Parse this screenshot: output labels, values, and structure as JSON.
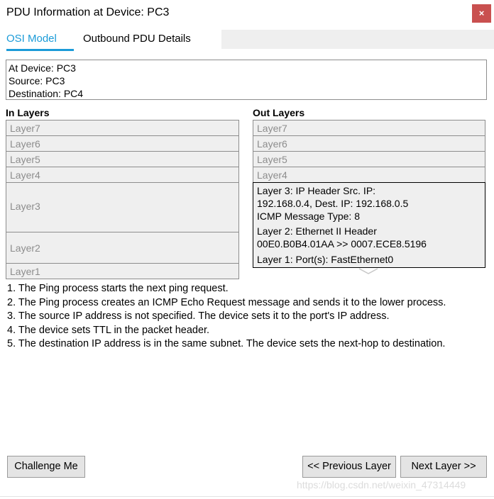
{
  "window": {
    "title": "PDU Information at Device: PC3",
    "close_label": "×",
    "close_icon": "close-icon",
    "accent_color": "#1b9bd8",
    "close_color": "#c9504f"
  },
  "tabs": [
    {
      "label": "OSI Model",
      "selected": true
    },
    {
      "label": "Outbound PDU Details",
      "selected": false
    }
  ],
  "info": {
    "at_device": "At Device: PC3",
    "source": "Source: PC3",
    "destination": "Destination: PC4"
  },
  "columns": {
    "in_heading": "In Layers",
    "out_heading": "Out Layers"
  },
  "in_layers": [
    {
      "text": "Layer7",
      "active": false
    },
    {
      "text": "Layer6",
      "active": false
    },
    {
      "text": "Layer5",
      "active": false
    },
    {
      "text": "Layer4",
      "active": false
    },
    {
      "text": "Layer3",
      "active": false
    },
    {
      "text": "Layer2",
      "active": false
    },
    {
      "text": "Layer1",
      "active": false
    }
  ],
  "out_layers": [
    {
      "lines": [
        "Layer7"
      ],
      "active": false
    },
    {
      "lines": [
        "Layer6"
      ],
      "active": false
    },
    {
      "lines": [
        "Layer5"
      ],
      "active": false
    },
    {
      "lines": [
        "Layer4"
      ],
      "active": false
    },
    {
      "lines": [
        "Layer 3: IP Header Src. IP:",
        "192.168.0.4, Dest. IP: 192.168.0.5",
        "ICMP Message Type: 8"
      ],
      "active": true
    },
    {
      "lines": [
        "Layer 2: Ethernet II Header",
        "00E0.B0B4.01AA >> 0007.ECE8.5196"
      ],
      "active": true
    },
    {
      "lines": [
        "Layer 1: Port(s): FastEthernet0"
      ],
      "active": true
    }
  ],
  "description": [
    "1. The Ping process starts the next ping request.",
    "2. The Ping process creates an ICMP Echo Request message and sends it to the lower process.",
    "3. The source IP address is not specified. The device sets it to the port's IP address.",
    "4. The device sets TTL in the packet header.",
    "5. The destination IP address is in the same subnet. The device sets the next-hop to destination."
  ],
  "footer": {
    "challenge_label": "Challenge Me",
    "previous_label": "<< Previous Layer",
    "next_label": "Next Layer >>"
  },
  "watermark": "https://blog.csdn.net/weixin_47314449"
}
